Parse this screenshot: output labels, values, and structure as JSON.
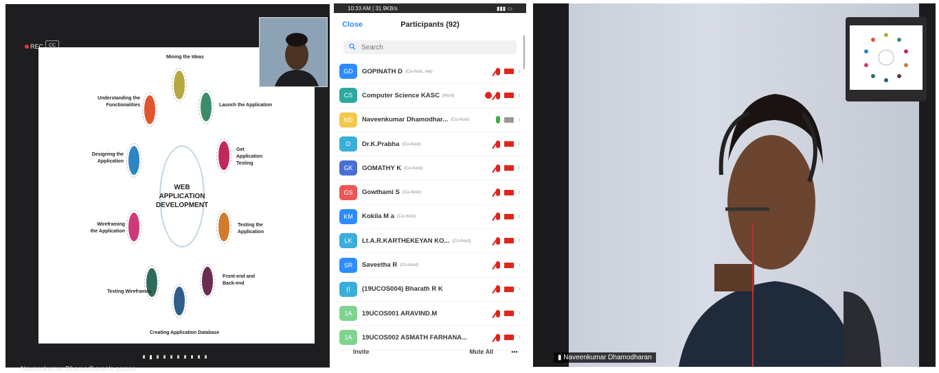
{
  "left_panel": {
    "rec_label": "REC",
    "cc_label": "CC",
    "slide": {
      "center_title": "WEB APPLICATION DEVELOPMENT",
      "steps": [
        "Mining the Ideas",
        "Launch the Application",
        "Get Application Testing",
        "Testing the Application",
        "Front-end and Back-end",
        "Creating Application Database",
        "Testing Wireframes",
        "Wireframing the Application",
        "Designing the Application",
        "Understanding the Functionalities"
      ],
      "step_colors": [
        "#b7a742",
        "#3c8c6b",
        "#c2285b",
        "#d07c2c",
        "#6a2d52",
        "#2f5e8a",
        "#2f6b5a",
        "#cf3b7a",
        "#2d86c4",
        "#e2552e"
      ]
    },
    "page_dots": {
      "total": 10,
      "active": 1
    },
    "caption": "Naveenkumar Dhamodharan's screen"
  },
  "participants_panel": {
    "status_time": "10:33 AM | 31.9KB/s",
    "close_label": "Close",
    "title": "Participants (92)",
    "search_placeholder": "Search",
    "participants": [
      {
        "initials": "GD",
        "name": "GOPINATH D",
        "role": "(Co-host, me)",
        "avatar_color": "#2d8cff",
        "mic": "muted",
        "video": "off"
      },
      {
        "initials": "CS",
        "name": "Computer Science KASC",
        "role": "(Host)",
        "avatar_color": "#2ca8a0",
        "mic": "muted",
        "video": "off",
        "recording": true
      },
      {
        "initials": "ND",
        "name": "Naveenkumar Dhamodhar...",
        "role": "(Co-host)",
        "avatar_color": "#f2c94c",
        "mic": "on",
        "video": "grey"
      },
      {
        "initials": "D",
        "name": "Dr.K.Prabha",
        "role": "(Co-host)",
        "avatar_color": "#3aaedb",
        "mic": "muted",
        "video": "off"
      },
      {
        "initials": "GK",
        "name": "GOMATHY K",
        "role": "(Co-host)",
        "avatar_color": "#4a6fd4",
        "mic": "muted",
        "video": "off"
      },
      {
        "initials": "GS",
        "name": "Gowthami S",
        "role": "(Co-host)",
        "avatar_color": "#eb5757",
        "mic": "muted",
        "video": "off"
      },
      {
        "initials": "KM",
        "name": "Kokila M a",
        "role": "(Co-host)",
        "avatar_color": "#2d8cff",
        "mic": "muted",
        "video": "off"
      },
      {
        "initials": "LK",
        "name": "Lt.A.R.KARTHEKEYAN KO...",
        "role": "(Co-host)",
        "avatar_color": "#3aaedb",
        "mic": "muted",
        "video": "off"
      },
      {
        "initials": "SR",
        "name": "Saveetha R",
        "role": "(Co-host)",
        "avatar_color": "#2d8cff",
        "mic": "muted",
        "video": "off"
      },
      {
        "initials": "(I",
        "name": "(19UCOS004) Bharath R K",
        "role": "",
        "avatar_color": "#3aaedb",
        "mic": "muted",
        "video": "off"
      },
      {
        "initials": "1A",
        "name": "19UCOS001 ARAVIND.M",
        "role": "",
        "avatar_color": "#7ed38f",
        "mic": "muted",
        "video": "off"
      },
      {
        "initials": "1A",
        "name": "19UCOS002 ASMATH FARHANA...",
        "role": "",
        "avatar_color": "#7ed38f",
        "mic": "muted",
        "video": "off"
      }
    ],
    "footer": {
      "invite_label": "Invite",
      "mute_all_label": "Mute All",
      "more_label": "•••"
    }
  },
  "right_panel": {
    "name_tag": "Naveenkumar Dhamodharan"
  }
}
